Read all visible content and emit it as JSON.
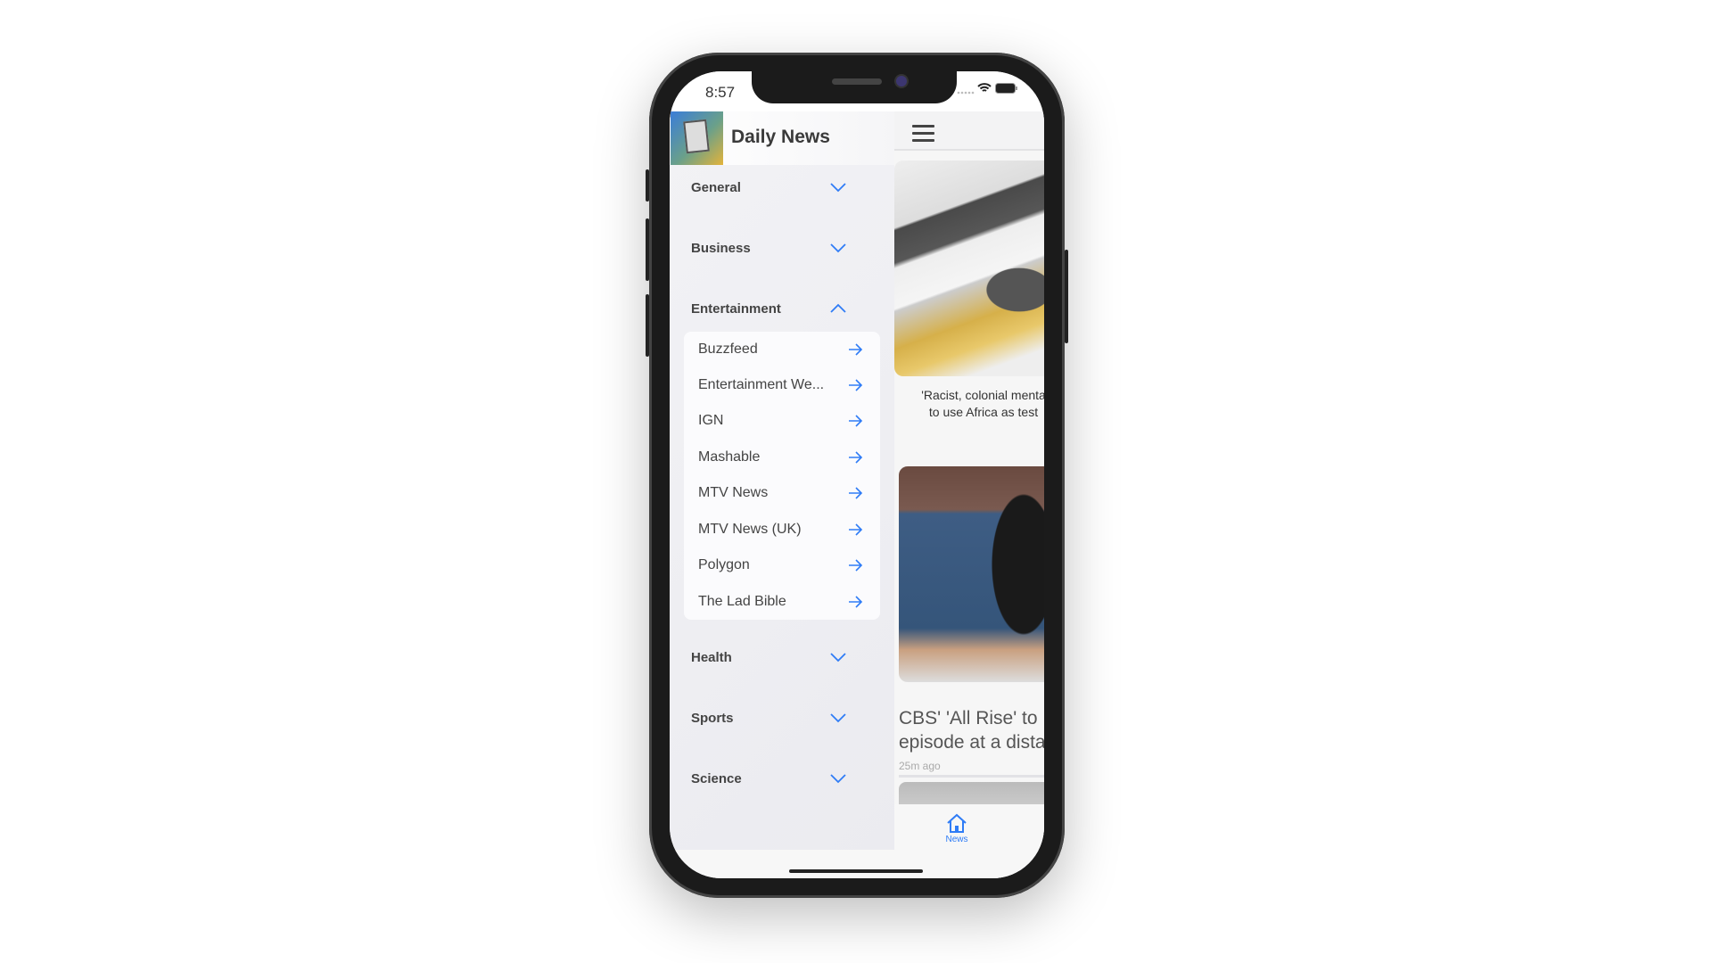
{
  "status": {
    "time": "8:57"
  },
  "sidebar": {
    "app_title": "Daily News",
    "categories": [
      {
        "label": "General",
        "expanded": false
      },
      {
        "label": "Business",
        "expanded": false
      },
      {
        "label": "Entertainment",
        "expanded": true
      },
      {
        "label": "Health",
        "expanded": false
      },
      {
        "label": "Sports",
        "expanded": false
      },
      {
        "label": "Science",
        "expanded": false
      }
    ],
    "entertainment_sources": [
      "Buzzfeed",
      "Entertainment We...",
      "IGN",
      "Mashable",
      "MTV News",
      "MTV News (UK)",
      "Polygon",
      "The Lad Bible"
    ]
  },
  "main": {
    "carousel_caption_line1": "'Racist, colonial menta",
    "carousel_caption_line2": "to use Africa as test",
    "carousel_active_index": 1,
    "article": {
      "headline_line1": "CBS' 'All Rise' to",
      "headline_line2": "episode at a dista",
      "time": "25m ago"
    },
    "tabbar": {
      "news_label": "News"
    }
  },
  "colors": {
    "accent": "#2f7cf6",
    "dot_active": "#22cc22",
    "dot_inactive": "#aaaaaa"
  }
}
